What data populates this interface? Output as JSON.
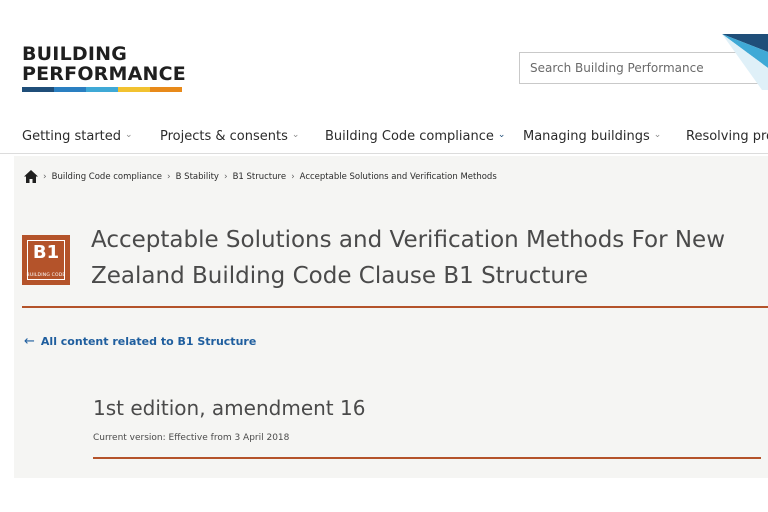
{
  "header": {
    "logo_line1": "BUILDING",
    "logo_line2": "PERFORMANCE",
    "logo_stripe_colors": [
      "#1f4e79",
      "#2a7fc1",
      "#3fa9d6",
      "#f2c230",
      "#e88a1a"
    ],
    "search_placeholder": "Search Building Performance"
  },
  "nav": {
    "items": [
      {
        "label": "Getting started",
        "active": false
      },
      {
        "label": "Projects & consents",
        "active": false
      },
      {
        "label": "Building Code compliance",
        "active": true
      },
      {
        "label": "Managing buildings",
        "active": false
      },
      {
        "label": "Resolving pro",
        "active": false
      }
    ],
    "chevron_icon": "chevron-down-icon"
  },
  "breadcrumb": {
    "home_icon": "home-icon",
    "items": [
      "Building Code compliance",
      "B Stability",
      "B1 Structure",
      "Acceptable Solutions and Verification Methods"
    ]
  },
  "page": {
    "badge_code": "B1",
    "badge_label": "BUILDING CODE",
    "title": "Acceptable Solutions and Verification Methods For New Zealand Building Code Clause B1 Structure",
    "back_link": "All content related to B1 Structure",
    "edition": "1st edition, amendment 16",
    "current_version": "Current version: Effective from 3 April 2018"
  },
  "colors": {
    "accent_rust": "#b4532a",
    "link_blue": "#1f5e9e",
    "nav_active": "#1f4e79",
    "content_bg": "#f5f5f3"
  }
}
